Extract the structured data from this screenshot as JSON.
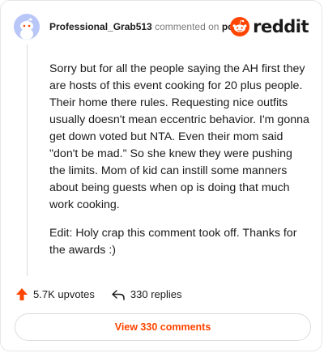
{
  "comment": {
    "username": "Professional_Grab513",
    "commented_text": "commented on",
    "post_link": "post",
    "paragraphs": [
      "Sorry but for all the people saying the AH first they are hosts of this event cooking for 20 plus people. Their home there rules. Requesting nice outfits usually doesn't mean eccentric behavior. I'm gonna get down voted but NTA. Even their mom said \"don't be mad.\" So she knew they were pushing the limits. Mom of kid can instill some manners about being guests when op is doing that much work cooking.",
      "Edit: Holy crap this comment took off. Thanks for the awards :)"
    ]
  },
  "brand": {
    "wordmark": "reddit",
    "icon": "reddit-snoo-icon",
    "color": "#ff4500"
  },
  "actions": {
    "upvotes": "5.7K upvotes",
    "replies": "330 replies",
    "upvote_icon": "upvote-arrow-icon",
    "reply_icon": "reply-arrow-icon",
    "accent": "#ff4500"
  },
  "footer": {
    "view_comments": "View 330 comments"
  }
}
